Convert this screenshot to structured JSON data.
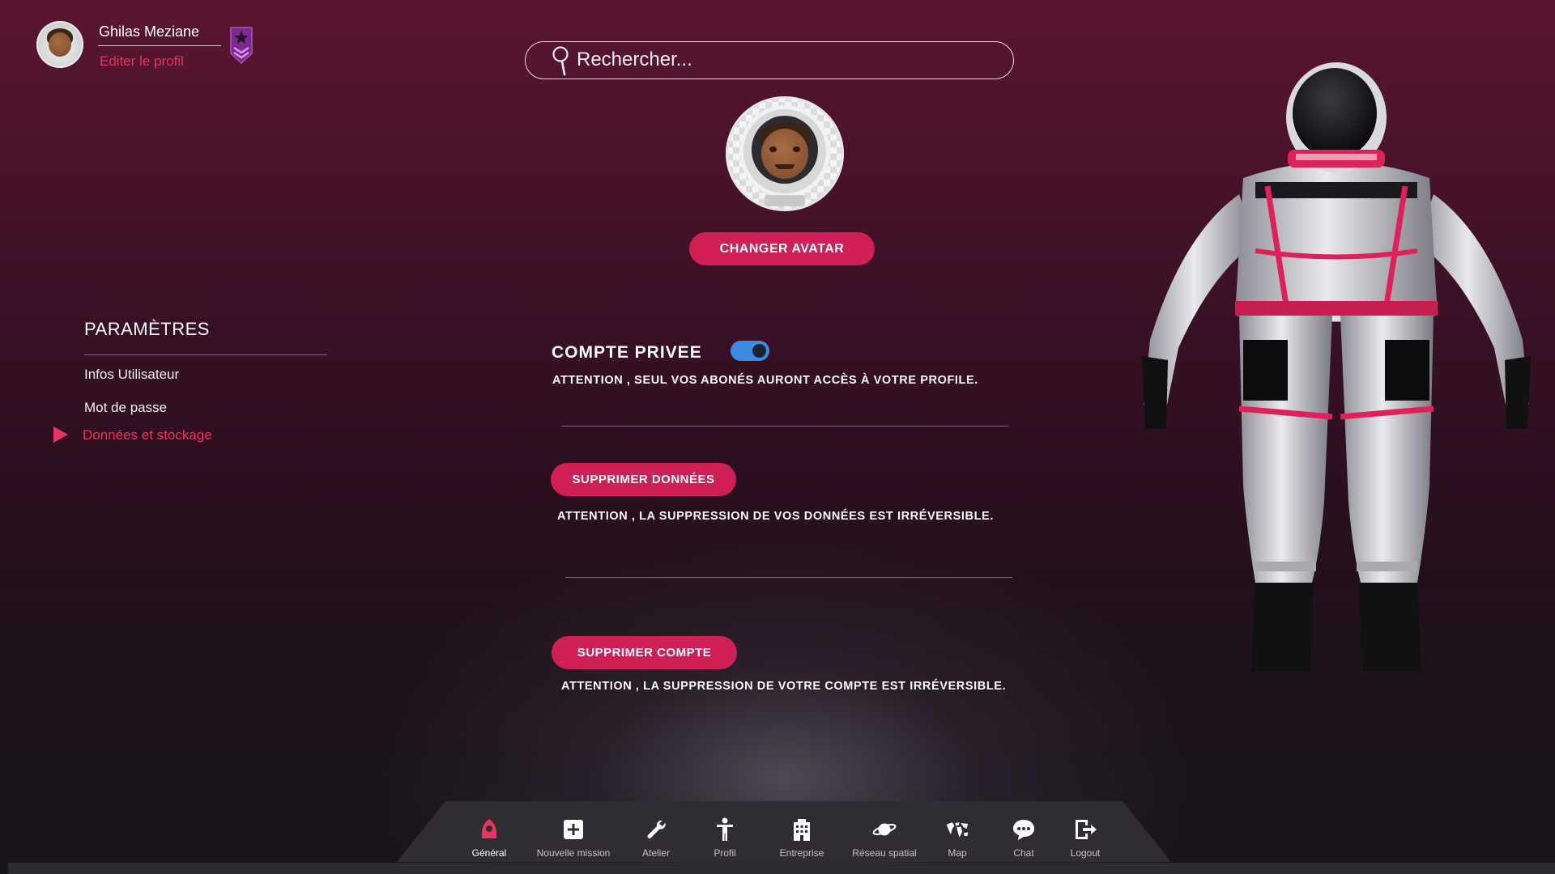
{
  "user": {
    "name": "Ghilas Meziane",
    "edit_label": "Editer le profil"
  },
  "search": {
    "placeholder": "Rechercher..."
  },
  "avatar": {
    "change_label": "CHANGER AVATAR"
  },
  "sidebar": {
    "title": "PARAMÈTRES",
    "items": [
      {
        "label": "Infos Utilisateur",
        "active": false
      },
      {
        "label": "Mot de passe",
        "active": false
      },
      {
        "label": "Données et stockage",
        "active": true
      }
    ]
  },
  "settings": {
    "private_account_label": "COMPTE PRIVEE",
    "private_account_enabled": true,
    "private_warning": "ATTENTION , SEUL VOS ABONÉS AURONT ACCÈS À VOTRE PROFILE.",
    "delete_data_label": "SUPPRIMER DONNÉES",
    "delete_data_warning": "ATTENTION , LA SUPPRESSION DE VOS DONNÉES EST IRRÉVERSIBLE.",
    "delete_account_label": "SUPPRIMER COMPTE",
    "delete_account_warning": "ATTENTION , LA SUPPRESSION DE VOTRE COMPTE EST IRRÉVERSIBLE."
  },
  "nav": {
    "items": [
      {
        "label": "Général",
        "icon": "rocket-icon",
        "active": true
      },
      {
        "label": "Nouvelle mission",
        "icon": "plus-square-icon",
        "active": false
      },
      {
        "label": "Atelier",
        "icon": "wrench-icon",
        "active": false
      },
      {
        "label": "Profil",
        "icon": "person-icon",
        "active": false
      },
      {
        "label": "Entreprise",
        "icon": "building-icon",
        "active": false
      },
      {
        "label": "Réseau spatial",
        "icon": "planet-icon",
        "active": false
      },
      {
        "label": "Map",
        "icon": "world-map-icon",
        "active": false
      },
      {
        "label": "Chat",
        "icon": "chat-bubble-icon",
        "active": false
      },
      {
        "label": "Logout",
        "icon": "logout-icon",
        "active": false
      }
    ]
  },
  "colors": {
    "accent": "#cf1f55",
    "link": "#e8345f",
    "toggle": "#3d8be0",
    "badge": "#7d2a8f"
  }
}
